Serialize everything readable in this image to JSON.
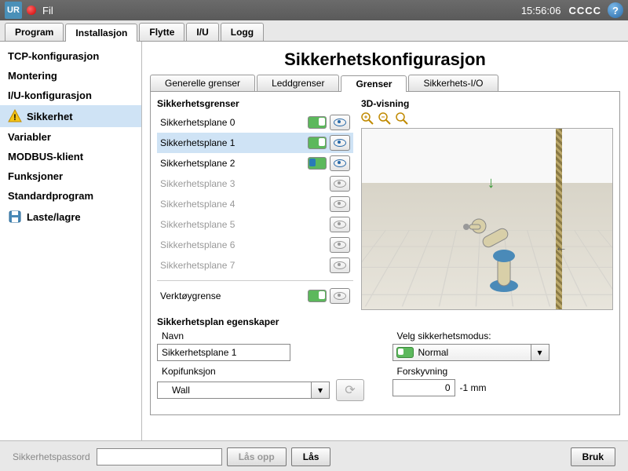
{
  "topbar": {
    "logo": "UR",
    "menu_file": "Fil",
    "time": "15:56:06",
    "status": "CCCC"
  },
  "main_tabs": [
    "Program",
    "Installasjon",
    "Flytte",
    "I/U",
    "Logg"
  ],
  "main_tab_active": 1,
  "sidebar": {
    "items": [
      {
        "label": "TCP-konfigurasjon"
      },
      {
        "label": "Montering"
      },
      {
        "label": "I/U-konfigurasjon"
      },
      {
        "label": "Sikkerhet",
        "icon": "warning",
        "selected": true
      },
      {
        "label": "Variabler"
      },
      {
        "label": "MODBUS-klient"
      },
      {
        "label": "Funksjoner"
      },
      {
        "label": "Standardprogram"
      },
      {
        "label": "Laste/lagre",
        "icon": "save"
      }
    ]
  },
  "page_title": "Sikkerhetskonfigurasjon",
  "sub_tabs": [
    "Generelle grenser",
    "Leddgrenser",
    "Grenser",
    "Sikkerhets-I/O"
  ],
  "sub_tab_active": 2,
  "limits": {
    "heading": "Sikkerhetsgrenser",
    "planes": [
      {
        "label": "Sikkerhetsplane 0",
        "state": "on",
        "eye": true
      },
      {
        "label": "Sikkerhetsplane 1",
        "state": "on",
        "eye": true,
        "selected": true
      },
      {
        "label": "Sikkerhetsplane 2",
        "state": "config",
        "eye": true
      },
      {
        "label": "Sikkerhetsplane 3",
        "state": "off",
        "eye": false
      },
      {
        "label": "Sikkerhetsplane 4",
        "state": "off",
        "eye": false
      },
      {
        "label": "Sikkerhetsplane 5",
        "state": "off",
        "eye": false
      },
      {
        "label": "Sikkerhetsplane 6",
        "state": "off",
        "eye": false
      },
      {
        "label": "Sikkerhetsplane 7",
        "state": "off",
        "eye": false
      }
    ],
    "tool_label": "Verktøygrense",
    "tool_state": "on"
  },
  "viewer": {
    "heading": "3D-visning"
  },
  "props": {
    "heading": "Sikkerhetsplan egenskaper",
    "name_label": "Navn",
    "name_value": "Sikkerhetsplane 1",
    "mode_label": "Velg sikkerhetsmodus:",
    "mode_value": "Normal",
    "copy_label": "Kopifunksjon",
    "copy_value": "Wall",
    "offset_label": "Forskyvning",
    "offset_value": "0",
    "offset_unit": "-1 mm"
  },
  "bottom": {
    "pwd_label": "Sikkerhetspassord",
    "unlock": "Lås opp",
    "lock": "Lås",
    "apply": "Bruk"
  }
}
